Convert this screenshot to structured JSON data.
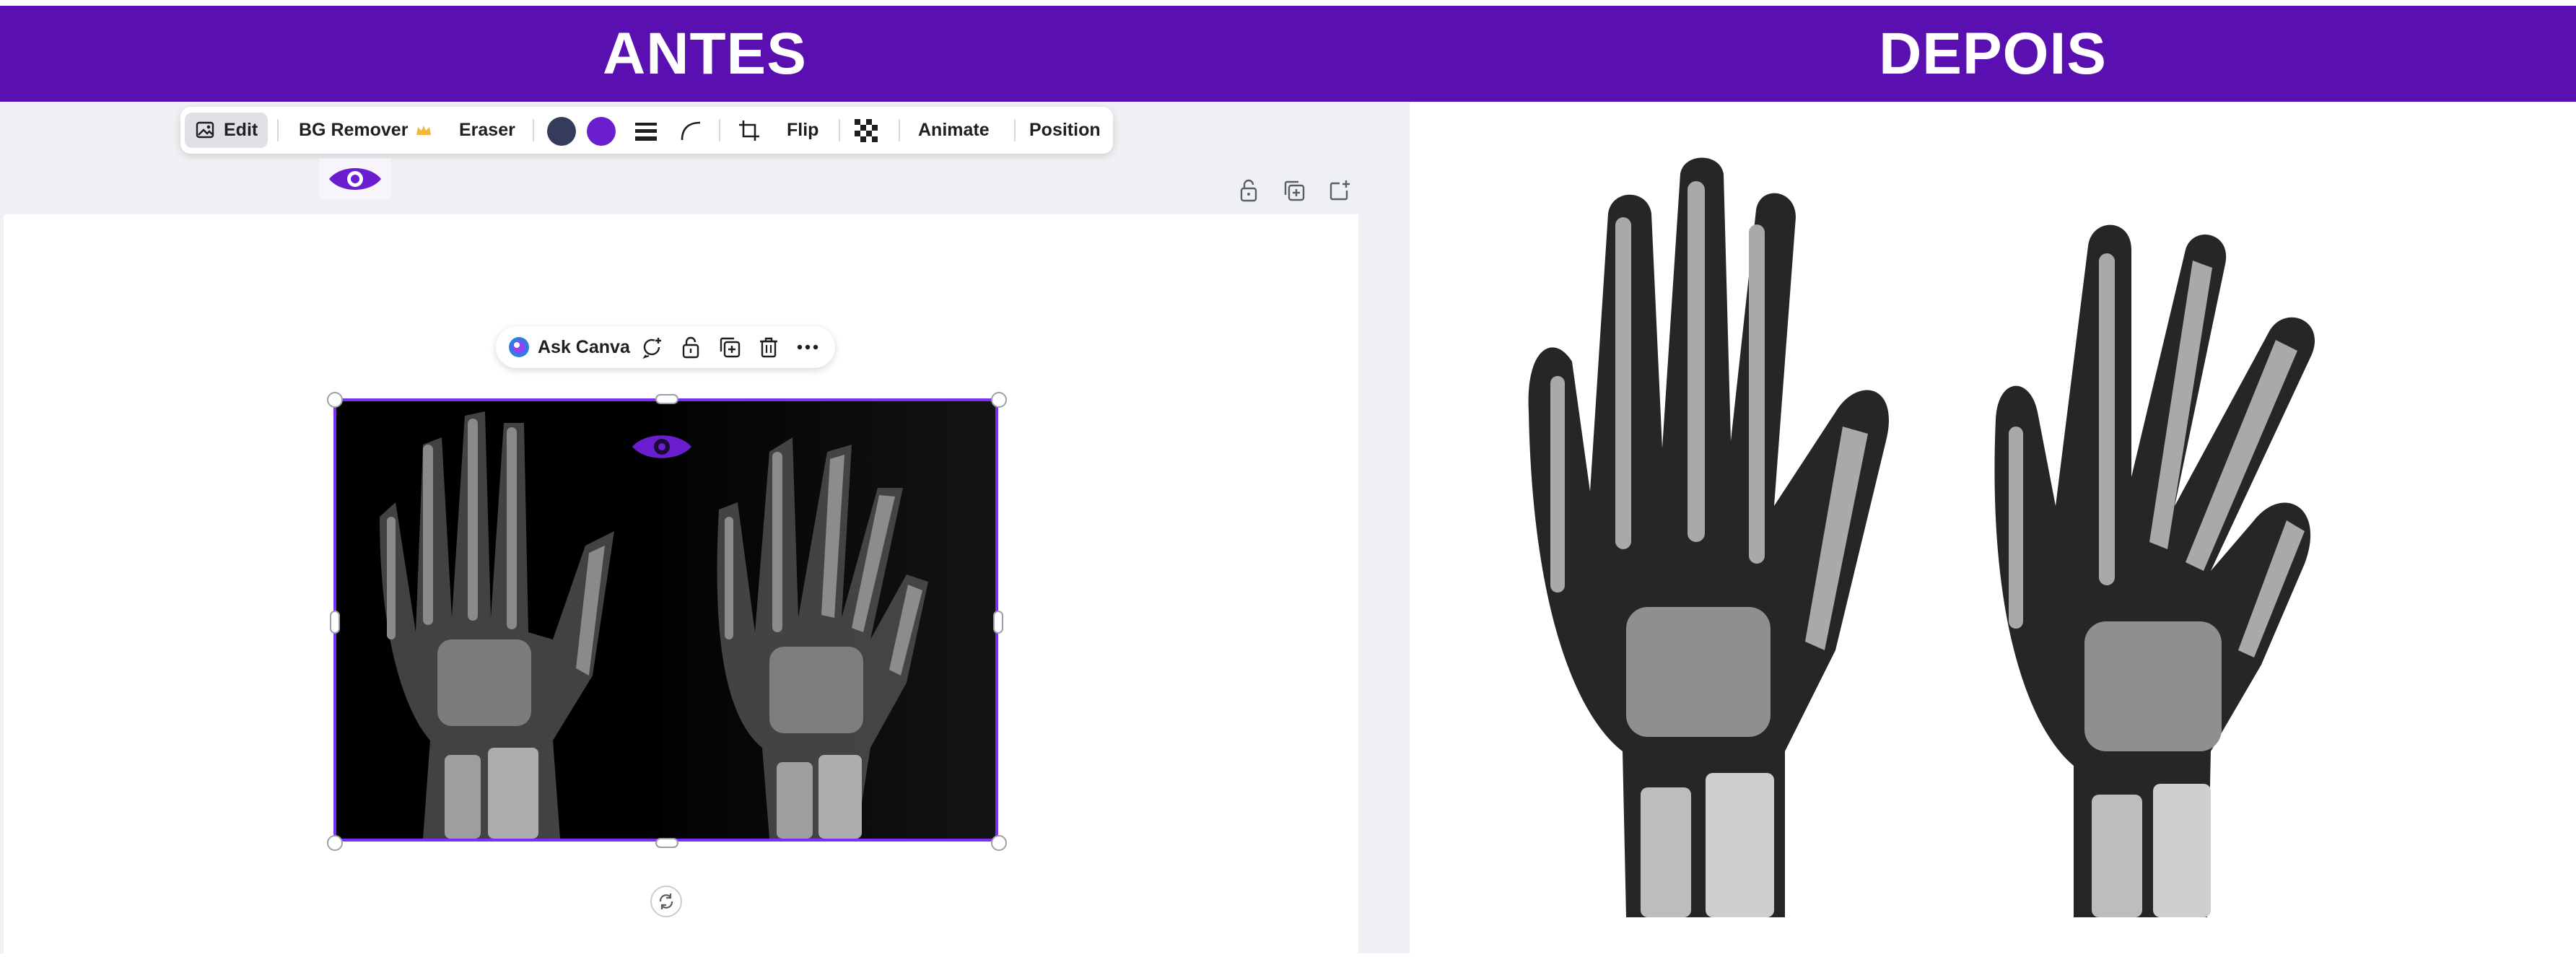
{
  "banner": {
    "left_title": "ANTES",
    "right_title": "DEPOIS",
    "color": "#5a0fb0"
  },
  "toolbar": {
    "edit": "Edit",
    "bg_remover": "BG Remover",
    "eraser": "Eraser",
    "flip": "Flip",
    "animate": "Animate",
    "position": "Position",
    "swatches": [
      "#353b5a",
      "#6a1ed0"
    ],
    "icons": [
      "image-edit-icon",
      "crown-icon",
      "line-weight-icon",
      "corner-rounding-icon",
      "crop-icon",
      "transparency-icon"
    ]
  },
  "page_tools": {
    "icons": [
      "lock-icon",
      "duplicate-icon",
      "add-page-icon"
    ]
  },
  "context_menu": {
    "ask_canva": "Ask Canva",
    "icons": [
      "canva-ai-icon",
      "comment-add-icon",
      "lock-icon",
      "duplicate-icon",
      "trash-icon",
      "more-icon"
    ]
  },
  "colors": {
    "accent": "#7b2ff7",
    "eye": "#6a1ed0",
    "canvas_bg": "#eef0f3"
  }
}
